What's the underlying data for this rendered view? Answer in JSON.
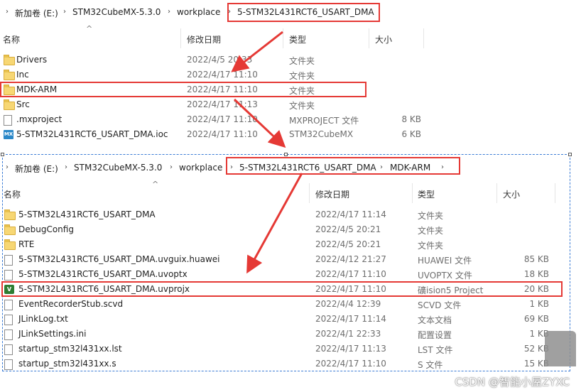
{
  "top": {
    "breadcrumb": [
      "新加卷 (E:)",
      "STM32CubeMX-5.3.0",
      "workplace",
      "5-STM32L431RCT6_USART_DMA"
    ],
    "columns": {
      "name": "名称",
      "date": "修改日期",
      "type": "类型",
      "size": "大小"
    },
    "rows": [
      {
        "icon": "folder",
        "name": "Drivers",
        "date": "2022/4/5 20:33",
        "type": "文件夹",
        "size": ""
      },
      {
        "icon": "folder",
        "name": "Inc",
        "date": "2022/4/17 11:10",
        "type": "文件夹",
        "size": ""
      },
      {
        "icon": "folder",
        "name": "MDK-ARM",
        "date": "2022/4/17 11:10",
        "type": "文件夹",
        "size": ""
      },
      {
        "icon": "folder",
        "name": "Src",
        "date": "2022/4/17 11:13",
        "type": "文件夹",
        "size": ""
      },
      {
        "icon": "file",
        "name": ".mxproject",
        "date": "2022/4/17 11:10",
        "type": "MXPROJECT 文件",
        "size": "8 KB"
      },
      {
        "icon": "mx",
        "name": "5-STM32L431RCT6_USART_DMA.ioc",
        "date": "2022/4/17 11:10",
        "type": "STM32CubeMX",
        "size": "6 KB"
      }
    ]
  },
  "bottom": {
    "breadcrumb": [
      "新加卷 (E:)",
      "STM32CubeMX-5.3.0",
      "workplace",
      "5-STM32L431RCT6_USART_DMA",
      "MDK-ARM"
    ],
    "columns": {
      "name": "名称",
      "date": "修改日期",
      "type": "类型",
      "size": "大小"
    },
    "rows": [
      {
        "icon": "folder",
        "name": "5-STM32L431RCT6_USART_DMA",
        "date": "2022/4/17 11:14",
        "type": "文件夹",
        "size": ""
      },
      {
        "icon": "folder",
        "name": "DebugConfig",
        "date": "2022/4/5 20:21",
        "type": "文件夹",
        "size": ""
      },
      {
        "icon": "folder",
        "name": "RTE",
        "date": "2022/4/5 20:21",
        "type": "文件夹",
        "size": ""
      },
      {
        "icon": "file",
        "name": "5-STM32L431RCT6_USART_DMA.uvguix.huawei",
        "date": "2022/4/12 21:27",
        "type": "HUAWEI 文件",
        "size": "85 KB"
      },
      {
        "icon": "file",
        "name": "5-STM32L431RCT6_USART_DMA.uvoptx",
        "date": "2022/4/17 11:10",
        "type": "UVOPTX 文件",
        "size": "18 KB"
      },
      {
        "icon": "uv",
        "name": "5-STM32L431RCT6_USART_DMA.uvprojx",
        "date": "2022/4/17 11:10",
        "type": "礦ision5 Project",
        "size": "20 KB"
      },
      {
        "icon": "file",
        "name": "EventRecorderStub.scvd",
        "date": "2022/4/4 12:39",
        "type": "SCVD 文件",
        "size": "1 KB"
      },
      {
        "icon": "file",
        "name": "JLinkLog.txt",
        "date": "2022/4/17 11:14",
        "type": "文本文档",
        "size": "69 KB"
      },
      {
        "icon": "file",
        "name": "JLinkSettings.ini",
        "date": "2022/4/1 22:33",
        "type": "配置设置",
        "size": "1 KB"
      },
      {
        "icon": "file",
        "name": "startup_stm32l431xx.lst",
        "date": "2022/4/17 11:13",
        "type": "LST 文件",
        "size": "52 KB"
      },
      {
        "icon": "file",
        "name": "startup_stm32l431xx.s",
        "date": "2022/4/17 11:10",
        "type": "S 文件",
        "size": "15 KB"
      }
    ]
  },
  "watermark": "CSDN @智能小屋ZYXC",
  "icon_glyphs": {
    "mx": "MX",
    "uv": "V"
  },
  "colors": {
    "highlight": "#e53935",
    "selection": "#3a7bd5",
    "folder": "#f7d774"
  }
}
